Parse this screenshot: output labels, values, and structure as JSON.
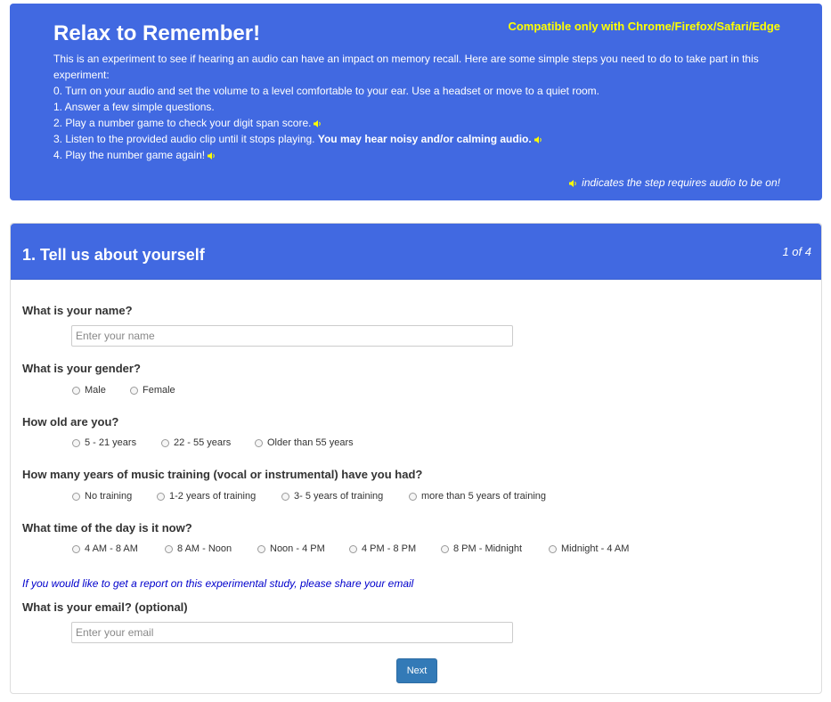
{
  "header": {
    "title": "Relax to Remember!",
    "compat_note": "Compatible only with Chrome/Firefox/Safari/Edge",
    "intro": "This is an experiment to see if hearing an audio can have an impact on memory recall. Here are some simple steps you need to do to take part in this experiment:",
    "steps": [
      "0. Turn on your audio and set the volume to a level comfortable to your ear. Use a headset or move to a quiet room.",
      "1. Answer a few simple questions.",
      "2. Play a number game to check your digit span score.",
      "3. Listen to the provided audio clip until it stops playing.",
      "4. Play the number game again!"
    ],
    "step3_bold": "You may hear noisy and/or calming audio.",
    "legend": "indicates the step requires audio to be on!",
    "audio_icon": "speaker-icon",
    "colors": {
      "background": "#4169e1",
      "accent": "#ffff00",
      "text": "#ffffff"
    }
  },
  "panel": {
    "title": "1. Tell us about yourself",
    "step_indicator": "1 of 4",
    "name_question": "What is your name?",
    "name_placeholder": "Enter your name",
    "name_value": "",
    "gender_question": "What is your gender?",
    "gender_options": [
      "Male",
      "Female"
    ],
    "age_question": "How old are you?",
    "age_options": [
      "5 - 21 years",
      "22 - 55 years",
      "Older than 55 years"
    ],
    "music_question": "How many years of music training (vocal or instrumental) have you had?",
    "music_options": [
      "No training",
      "1-2 years of training",
      "3- 5 years of training",
      "more than 5 years of training"
    ],
    "time_question": "What time of the day is it now?",
    "time_options": [
      "4 AM - 8 AM",
      "8 AM - Noon",
      "Noon - 4 PM",
      "4 PM - 8 PM",
      "8 PM - Midnight",
      "Midnight - 4 AM"
    ],
    "report_note": "If you would like to get a report on this experimental study, please share your email",
    "email_question": "What is your email? (optional)",
    "email_placeholder": "Enter your email",
    "email_value": "",
    "next_label": "Next",
    "colors": {
      "header": "#4169e1",
      "note": "#0000cc",
      "button": "#337ab7"
    }
  }
}
